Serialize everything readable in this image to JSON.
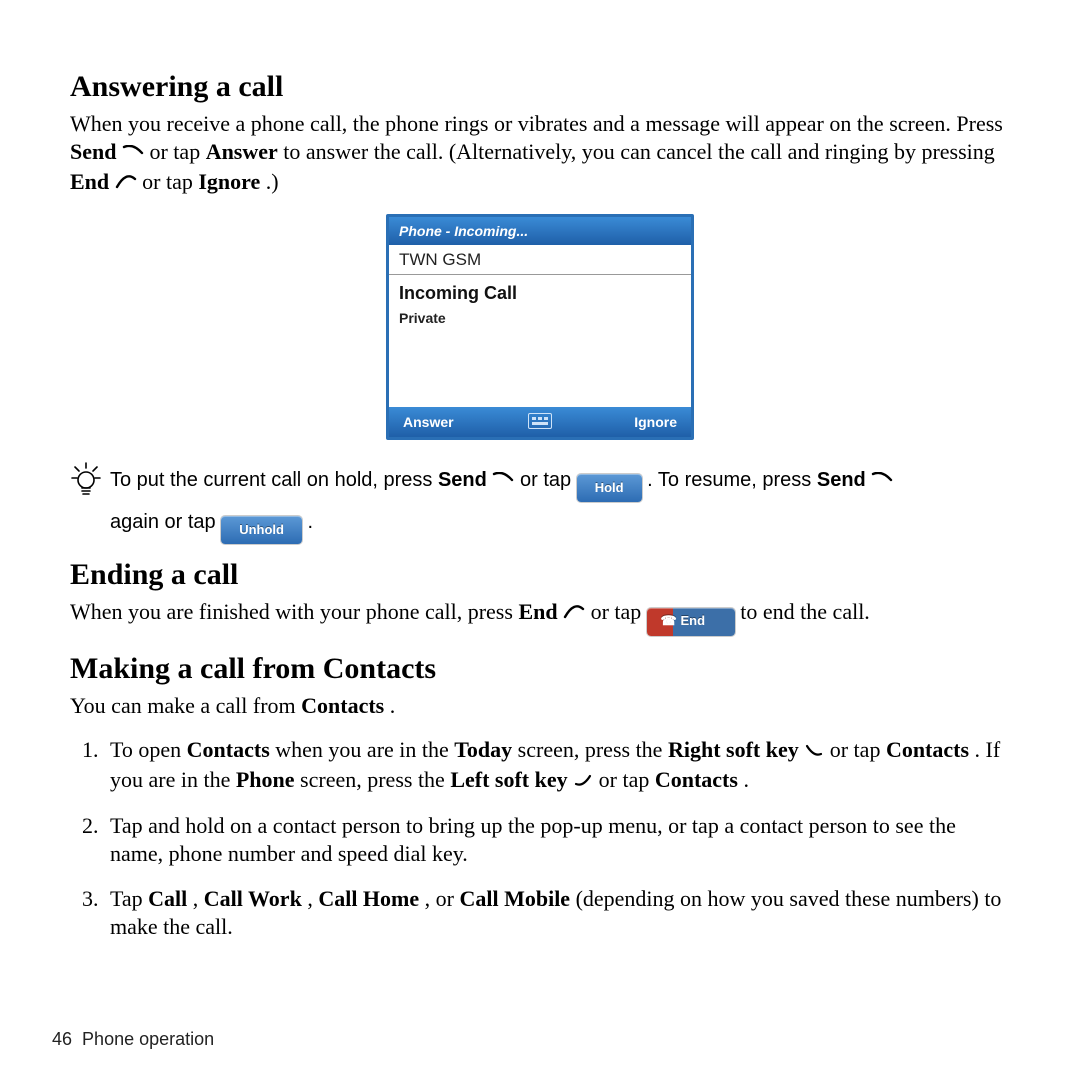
{
  "sec1": {
    "heading": "Answering a call",
    "para_pre": "When you receive a phone call, the phone rings or vibrates and a message will appear on the screen. Press ",
    "send": "Send",
    "para_mid1": " or tap ",
    "answer": "Answer",
    "para_mid2": " to answer the call. (Alternatively, you can cancel the call and ringing by pressing ",
    "end": "End",
    "para_mid3": " or tap ",
    "ignore": "Ignore",
    "para_post": ".)"
  },
  "phonebox": {
    "title": "Phone - Incoming...",
    "carrier": "TWN GSM",
    "incoming": "Incoming Call",
    "caller": "Private",
    "soft_left": "Answer",
    "soft_right": "Ignore"
  },
  "tip": {
    "t1": "To put the current call on hold, press ",
    "send": "Send",
    "t2": " or tap ",
    "hold_btn": "Hold",
    "t3": " . To resume, press ",
    "t4": " again or tap ",
    "unhold_btn": "Unhold",
    "t5": " ."
  },
  "sec2": {
    "heading": "Ending a call",
    "p_pre": "When you are finished with your phone call, press ",
    "end": "End",
    "p_mid": " or tap ",
    "end_btn": "End",
    "p_post": " to end the call."
  },
  "sec3": {
    "heading": "Making a call from Contacts",
    "intro_pre": "You can make a call from ",
    "contacts": "Contacts",
    "intro_post": ".",
    "step1": {
      "a": "To open ",
      "contacts1": "Contacts",
      "b": " when you are in the ",
      "today": "Today",
      "c": " screen, press the ",
      "rsk": "Right soft key",
      "d": " or tap ",
      "contacts2": "Contacts",
      "e": ". If you are in the ",
      "phone": "Phone",
      "f": " screen, press the ",
      "lsk": "Left soft key",
      "g": " or tap ",
      "contacts3": "Contacts",
      "h": "."
    },
    "step2": "Tap and hold on a contact person to bring up the pop-up menu, or tap a contact person to see the name, phone number and speed dial key.",
    "step3": {
      "a": "Tap ",
      "call": "Call",
      "s1": ", ",
      "callwork": "Call Work",
      "s2": ", ",
      "callhome": "Call Home",
      "s3": ", or ",
      "callmobile": "Call Mobile",
      "b": " (depending on how you saved these numbers) to make the call."
    }
  },
  "footer": {
    "page": "46",
    "label": "Phone operation"
  }
}
